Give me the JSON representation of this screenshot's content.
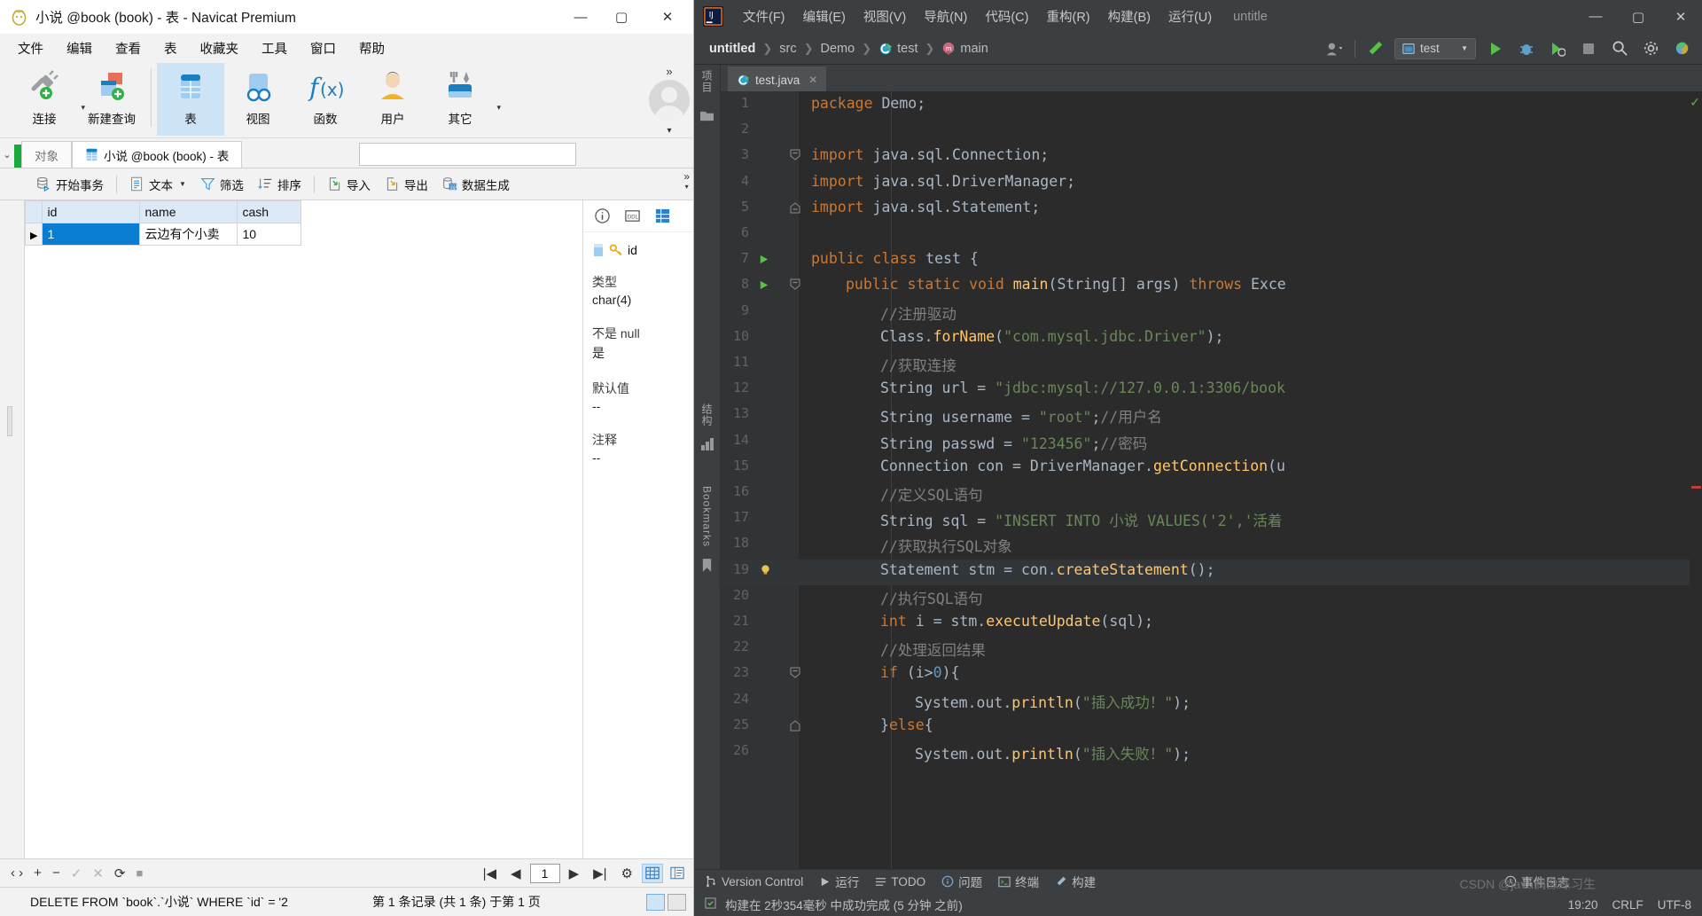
{
  "navicat": {
    "title": "小说 @book (book) - 表 - Navicat Premium",
    "window_controls": {
      "minimize": "—",
      "maximize": "▢",
      "close": "✕"
    },
    "menus": [
      "文件",
      "编辑",
      "查看",
      "表",
      "收藏夹",
      "工具",
      "窗口",
      "帮助"
    ],
    "ribbon": [
      {
        "label": "连接",
        "icon": "connect-icon",
        "has_dropdown": true,
        "selected": false
      },
      {
        "label": "新建查询",
        "icon": "new-query-icon",
        "has_dropdown": false,
        "selected": false
      },
      {
        "label": "表",
        "icon": "table-icon",
        "has_dropdown": false,
        "selected": true
      },
      {
        "label": "视图",
        "icon": "view-icon",
        "has_dropdown": false,
        "selected": false
      },
      {
        "label": "函数",
        "icon": "function-icon",
        "has_dropdown": false,
        "selected": false
      },
      {
        "label": "用户",
        "icon": "user-icon",
        "has_dropdown": false,
        "selected": false
      },
      {
        "label": "其它",
        "icon": "other-tools-icon",
        "has_dropdown": true,
        "selected": false
      }
    ],
    "ribbon_overflow": "»",
    "tabs": [
      {
        "label": "对象",
        "active": false
      },
      {
        "label": "小说 @book (book) - 表",
        "active": true
      }
    ],
    "search_value": "",
    "grid_toolbar": [
      {
        "label": "开始事务",
        "icon": "transaction-icon",
        "dropdown": false
      },
      {
        "label": "文本",
        "icon": "text-icon",
        "dropdown": true
      },
      {
        "label": "筛选",
        "icon": "filter-icon",
        "dropdown": false
      },
      {
        "label": "排序",
        "icon": "sort-icon",
        "dropdown": false
      },
      {
        "label": "导入",
        "icon": "import-icon",
        "dropdown": false
      },
      {
        "label": "导出",
        "icon": "export-icon",
        "dropdown": false
      },
      {
        "label": "数据生成",
        "icon": "data-generation-icon",
        "dropdown": false
      }
    ],
    "grid_toolbar_overflow": "»",
    "grid": {
      "columns": [
        "id",
        "name",
        "cash"
      ],
      "rows": [
        {
          "marker": "▶",
          "id": "1",
          "name": "云边有个小卖",
          "cash": "10",
          "selected": true
        }
      ]
    },
    "info_panel": {
      "icons": [
        "info-icon",
        "ddl-icon",
        "grid-icon"
      ],
      "field_name": "id",
      "field_icon": "key-icon",
      "properties": [
        {
          "label": "类型",
          "value": "char(4)"
        },
        {
          "label": "不是 null",
          "value": "是"
        },
        {
          "label": "默认值",
          "value": "--"
        },
        {
          "label": "注释",
          "value": "--"
        }
      ]
    },
    "record_nav": {
      "prev_next_toggle": "‹ ›",
      "add": "+",
      "remove": "−",
      "apply": "✓",
      "cancel": "✕",
      "refresh": "⟳",
      "stop": "■",
      "first": "|◀",
      "back": "◀",
      "page": "1",
      "forward": "▶",
      "last": "▶|",
      "settings": "⚙",
      "view_grid": "grid-view-icon",
      "view_form": "form-view-icon"
    },
    "status": {
      "sql": "DELETE FROM `book`.`小说` WHERE `id` = '2",
      "record_info": "第 1 条记录 (共 1 条) 于第 1 页"
    }
  },
  "idea": {
    "menus": [
      "文件(F)",
      "编辑(E)",
      "视图(V)",
      "导航(N)",
      "代码(C)",
      "重构(R)",
      "构建(B)",
      "运行(U)"
    ],
    "project_label": "untitle",
    "window_controls": {
      "minimize": "—",
      "maximize": "▢",
      "close": "✕"
    },
    "breadcrumbs": [
      {
        "label": "untitled",
        "icon": ""
      },
      {
        "label": "src",
        "icon": ""
      },
      {
        "label": "Demo",
        "icon": ""
      },
      {
        "label": "test",
        "icon": "class-icon"
      },
      {
        "label": "main",
        "icon": "method-icon"
      }
    ],
    "run_config": "test",
    "nav_actions": [
      "avatar-dropdown-icon",
      "build-hammer-icon",
      "run-icon",
      "debug-icon",
      "run-coverage-icon",
      "stop-icon",
      "search-icon",
      "settings-icon",
      "plugin-icon"
    ],
    "editor_tab": {
      "label": "test.java",
      "icon": "java-class-icon",
      "close": "✕"
    },
    "left_rail": [
      "项目",
      "结构",
      "Bookmarks"
    ],
    "code_lines": [
      {
        "n": 1,
        "indent": 0,
        "tokens": [
          [
            "kw",
            "package "
          ],
          [
            "pl",
            "Demo;"
          ]
        ]
      },
      {
        "n": 2,
        "indent": 0,
        "tokens": []
      },
      {
        "n": 3,
        "indent": 0,
        "fold": "start",
        "tokens": [
          [
            "kw",
            "import "
          ],
          [
            "pl",
            "java.sql.Connection;"
          ]
        ]
      },
      {
        "n": 4,
        "indent": 0,
        "tokens": [
          [
            "kw",
            "import "
          ],
          [
            "pl",
            "java.sql.DriverManager;"
          ]
        ]
      },
      {
        "n": 5,
        "indent": 0,
        "fold": "end",
        "tokens": [
          [
            "kw",
            "import "
          ],
          [
            "pl",
            "java.sql.Statement;"
          ]
        ]
      },
      {
        "n": 6,
        "indent": 0,
        "tokens": []
      },
      {
        "n": 7,
        "indent": 0,
        "run": true,
        "tokens": [
          [
            "kw",
            "public class "
          ],
          [
            "cls",
            "test"
          ],
          [
            "pl",
            " {"
          ]
        ]
      },
      {
        "n": 8,
        "indent": 1,
        "run": true,
        "fold": "start",
        "tokens": [
          [
            "kw",
            "public static void "
          ],
          [
            "mth",
            "main"
          ],
          [
            "pl",
            "("
          ],
          [
            "cls",
            "String"
          ],
          [
            "pl",
            "[] args) "
          ],
          [
            "kw",
            "throws "
          ],
          [
            "cls",
            "Exce"
          ]
        ]
      },
      {
        "n": 9,
        "indent": 2,
        "tokens": [
          [
            "cmt",
            "//注册驱动"
          ]
        ]
      },
      {
        "n": 10,
        "indent": 2,
        "tokens": [
          [
            "cls",
            "Class"
          ],
          [
            "pl",
            "."
          ],
          [
            "mth",
            "forName"
          ],
          [
            "pl",
            "("
          ],
          [
            "str",
            "\"com.mysql.jdbc.Driver\""
          ],
          [
            "pl",
            ");"
          ]
        ]
      },
      {
        "n": 11,
        "indent": 2,
        "tokens": [
          [
            "cmt",
            "//获取连接"
          ]
        ]
      },
      {
        "n": 12,
        "indent": 2,
        "tokens": [
          [
            "cls",
            "String"
          ],
          [
            "pl",
            " url = "
          ],
          [
            "str",
            "\"jdbc:mysql://127.0.0.1:3306/book"
          ]
        ]
      },
      {
        "n": 13,
        "indent": 2,
        "tokens": [
          [
            "cls",
            "String"
          ],
          [
            "pl",
            " username = "
          ],
          [
            "str",
            "\"root\""
          ],
          [
            "pl",
            ";"
          ],
          [
            "cmt",
            "//用户名"
          ]
        ]
      },
      {
        "n": 14,
        "indent": 2,
        "tokens": [
          [
            "cls",
            "String"
          ],
          [
            "pl",
            " passwd = "
          ],
          [
            "str",
            "\"123456\""
          ],
          [
            "pl",
            ";"
          ],
          [
            "cmt",
            "//密码"
          ]
        ]
      },
      {
        "n": 15,
        "indent": 2,
        "tokens": [
          [
            "cls",
            "Connection"
          ],
          [
            "pl",
            " con = "
          ],
          [
            "cls",
            "DriverManager"
          ],
          [
            "pl",
            "."
          ],
          [
            "mth",
            "getConnection"
          ],
          [
            "pl",
            "(u"
          ]
        ]
      },
      {
        "n": 16,
        "indent": 2,
        "tokens": [
          [
            "cmt",
            "//定义SQL语句"
          ]
        ]
      },
      {
        "n": 17,
        "indent": 2,
        "tokens": [
          [
            "cls",
            "String"
          ],
          [
            "pl",
            " sql = "
          ],
          [
            "str",
            "\"INSERT INTO 小说 VALUES('2','活着"
          ]
        ]
      },
      {
        "n": 18,
        "indent": 2,
        "tokens": [
          [
            "cmt",
            "//获取执行SQL对象"
          ]
        ]
      },
      {
        "n": 19,
        "indent": 2,
        "bulb": true,
        "highlight": true,
        "tokens": [
          [
            "cls",
            "Statement"
          ],
          [
            "pl",
            " stm = con."
          ],
          [
            "mth",
            "createStatement"
          ],
          [
            "pl",
            "();"
          ]
        ]
      },
      {
        "n": 20,
        "indent": 2,
        "tokens": [
          [
            "cmt",
            "//执行SQL语句"
          ]
        ]
      },
      {
        "n": 21,
        "indent": 2,
        "tokens": [
          [
            "kw",
            "int "
          ],
          [
            "pl",
            "i = "
          ],
          [
            "pl",
            "stm."
          ],
          [
            "mth",
            "executeUpdate"
          ],
          [
            "pl",
            "(sql);"
          ]
        ]
      },
      {
        "n": 22,
        "indent": 2,
        "tokens": [
          [
            "cmt",
            "//处理返回结果"
          ]
        ]
      },
      {
        "n": 23,
        "indent": 2,
        "fold": "start",
        "tokens": [
          [
            "kw",
            "if "
          ],
          [
            "pl",
            "(i>"
          ],
          [
            "num",
            "0"
          ],
          [
            "pl",
            "){"
          ]
        ]
      },
      {
        "n": 24,
        "indent": 3,
        "tokens": [
          [
            "cls",
            "System"
          ],
          [
            "pl",
            "."
          ],
          [
            "fn",
            "out"
          ],
          [
            "pl",
            "."
          ],
          [
            "mth",
            "println"
          ],
          [
            "pl",
            "("
          ],
          [
            "str",
            "\"插入成功！\""
          ],
          [
            "pl",
            ");"
          ]
        ]
      },
      {
        "n": 25,
        "indent": 2,
        "fold": "mid",
        "tokens": [
          [
            "pl",
            "}"
          ],
          [
            "kw",
            "else"
          ],
          [
            "pl",
            "{"
          ]
        ]
      },
      {
        "n": 26,
        "indent": 3,
        "tokens": [
          [
            "cls",
            "System"
          ],
          [
            "pl",
            "."
          ],
          [
            "fn",
            "out"
          ],
          [
            "pl",
            "."
          ],
          [
            "mth",
            "println"
          ],
          [
            "pl",
            "("
          ],
          [
            "str",
            "\"插入失败！\""
          ],
          [
            "pl",
            ");"
          ]
        ]
      }
    ],
    "bottom_tools": [
      {
        "label": "Version Control",
        "icon": "vcs-icon"
      },
      {
        "label": "运行",
        "icon": "run-icon"
      },
      {
        "label": "TODO",
        "icon": "todo-icon"
      },
      {
        "label": "问题",
        "icon": "problems-icon"
      },
      {
        "label": "终端",
        "icon": "terminal-icon"
      },
      {
        "label": "构建",
        "icon": "build-icon"
      }
    ],
    "event_log": {
      "label": "事件日志",
      "icon": "event-log-icon"
    },
    "build_status": "构建在 2秒354毫秒 中成功完成 (5 分钟 之前)",
    "build_status_icon": "build-status-icon",
    "status_right": {
      "time": "19:20",
      "line_sep": "CRLF",
      "encoding": "UTF-8"
    },
    "watermark": "CSDN @java偶像练习生"
  },
  "colors": {
    "navicat_accent": "#0a7cd1",
    "navicat_header": "#dceaf7",
    "idea_bg": "#3c3f41",
    "idea_editor_bg": "#2b2b2b",
    "keyword": "#cc7832",
    "string": "#6a8759",
    "comment": "#808080",
    "method": "#ffc66d",
    "number": "#6897bb"
  }
}
